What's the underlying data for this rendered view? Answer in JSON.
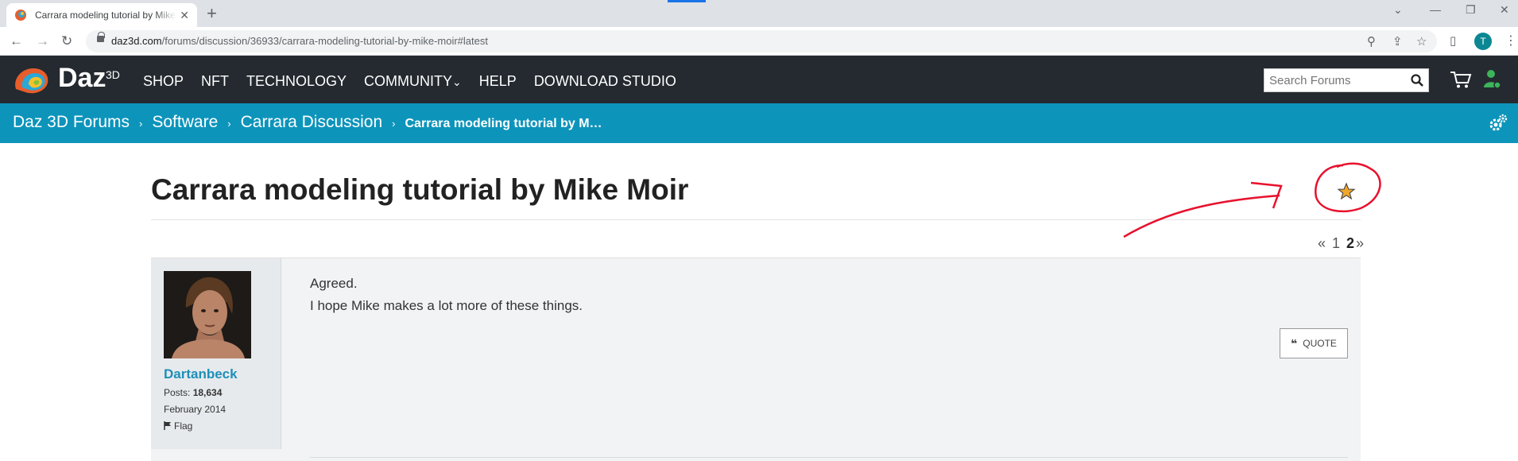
{
  "browser": {
    "tab_title": "Carrara modeling tutorial by Mike Moir | Daz 3D Forums",
    "tab_close": "✕",
    "new_tab": "+",
    "url_host": "daz3d.com",
    "url_path": "/forums/discussion/36933/carrara-modeling-tutorial-by-mike-moir#latest",
    "profile_initial": "T",
    "accent_color": "#1a73e8"
  },
  "site": {
    "logo_text": "Daz",
    "logo_sup": "3D",
    "nav": [
      "SHOP",
      "NFT",
      "TECHNOLOGY",
      "COMMUNITY",
      "HELP",
      "DOWNLOAD STUDIO"
    ],
    "community_caret": "⌄",
    "search_placeholder": "Search Forums",
    "header_color": "#242a30",
    "crumbbar_color": "#0d94bb"
  },
  "breadcrumb": {
    "items": [
      "Daz 3D Forums",
      "Software",
      "Carrara Discussion"
    ],
    "separator": "›",
    "current": "Carrara modeling tutorial by M…"
  },
  "discussion": {
    "title": "Carrara modeling tutorial by Mike Moir",
    "bookmark_icon": "star-icon",
    "pager": {
      "prev": "«",
      "pages": [
        "1",
        "2"
      ],
      "current": "2",
      "next": "»"
    }
  },
  "post": {
    "author": "Dartanbeck",
    "posts_label": "Posts:",
    "posts_count": "18,634",
    "joined": "February 2014",
    "flag_label": "Flag",
    "lines": [
      "Agreed.",
      "I hope Mike makes a lot more of these things."
    ],
    "quote_label": "QUOTE",
    "quote_icon": "❝"
  },
  "annotation_color": "#e8112d"
}
